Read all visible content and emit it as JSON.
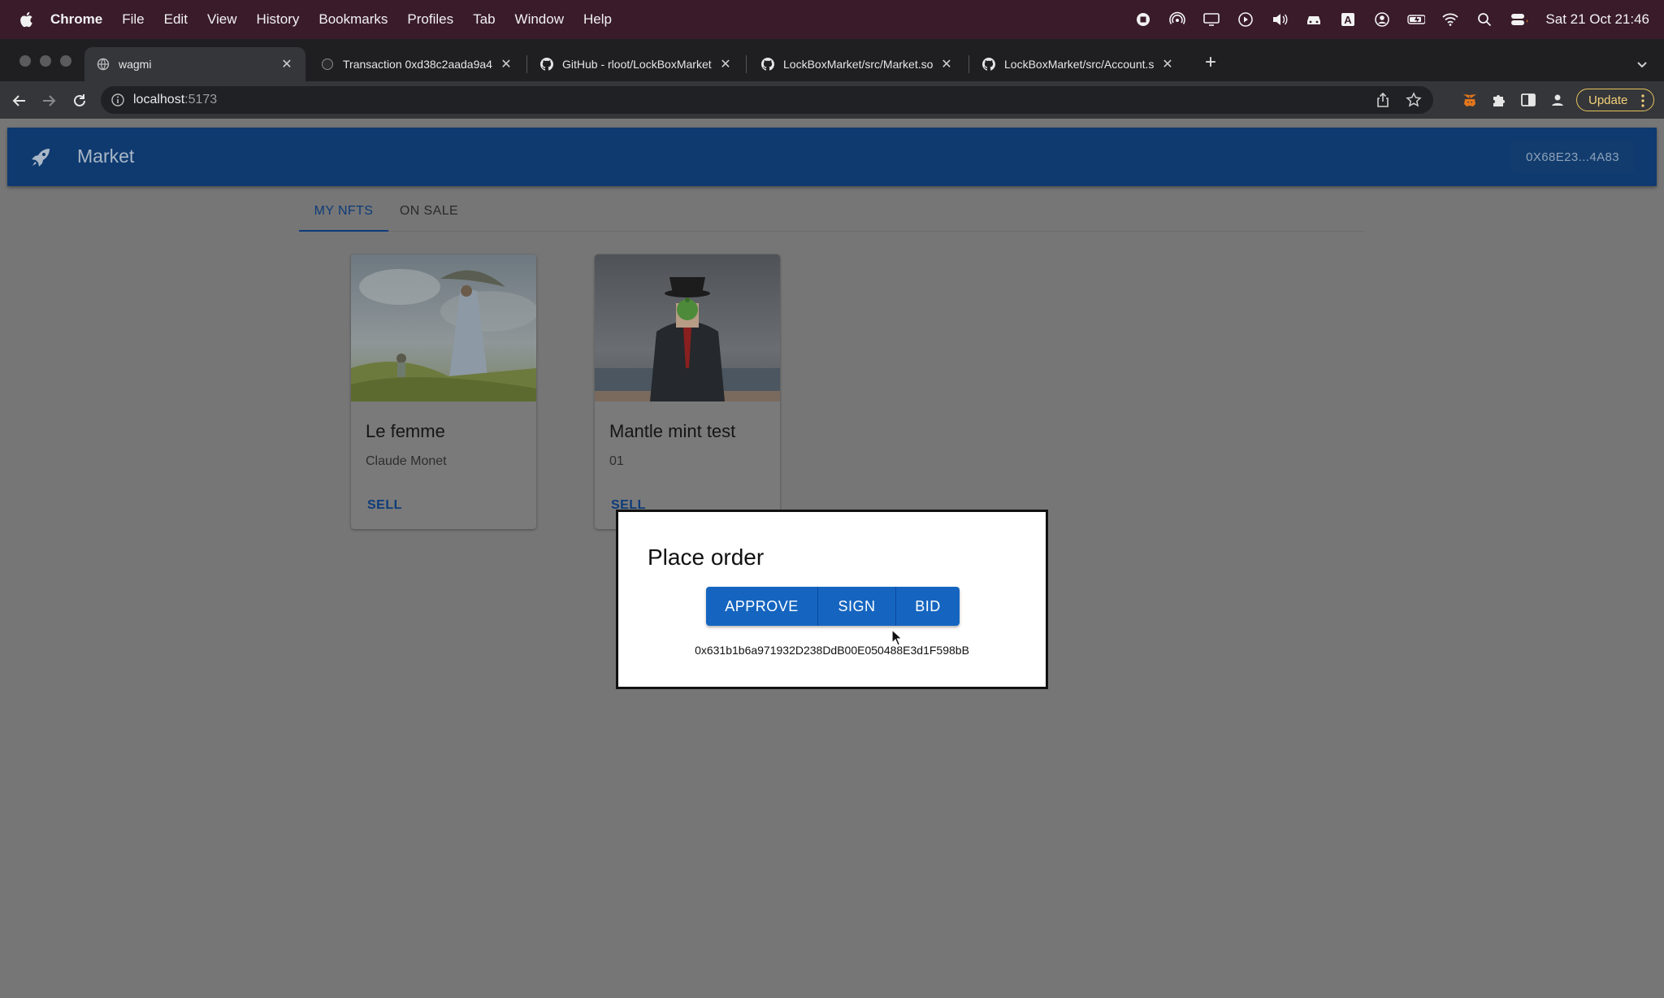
{
  "menubar": {
    "app": "Chrome",
    "items": [
      "File",
      "Edit",
      "View",
      "History",
      "Bookmarks",
      "Profiles",
      "Tab",
      "Window",
      "Help"
    ],
    "clock": "Sat 21 Oct  21:46"
  },
  "browser": {
    "tabs": [
      {
        "title": "wagmi"
      },
      {
        "title": "Transaction 0xd38c2aada9a4"
      },
      {
        "title": "GitHub - rloot/LockBoxMarket"
      },
      {
        "title": "LockBoxMarket/src/Market.sol"
      },
      {
        "title": "LockBoxMarket/src/Account.sol"
      }
    ],
    "url_host": "localhost",
    "url_port": ":5173",
    "update_label": "Update"
  },
  "app": {
    "brand": "Market",
    "wallet": "0X68E23...4A83",
    "tabs": [
      "MY NFTS",
      "ON SALE"
    ],
    "cards": [
      {
        "title": "Le femme",
        "subtitle": "Claude Monet",
        "action": "SELL"
      },
      {
        "title": "Mantle mint test",
        "subtitle": "01",
        "action": "SELL"
      }
    ]
  },
  "modal": {
    "title": "Place order",
    "buttons": [
      "APPROVE",
      "SIGN",
      "BID"
    ],
    "address": "0x631b1b6a971932D238DdB00E050488E3d1F598bB"
  }
}
